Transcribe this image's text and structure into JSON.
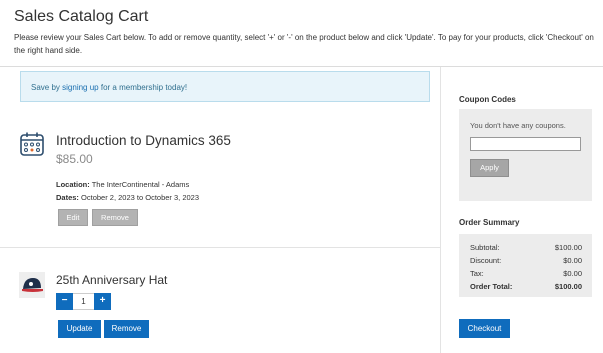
{
  "page": {
    "title": "Sales Catalog Cart",
    "intro": "Please review your Sales Cart below. To add or remove quantity, select '+' or '-' on the product below and click 'Update'. To pay for your products, click 'Checkout' on the right hand side."
  },
  "banner": {
    "prefix": "Save by ",
    "link": "signing up",
    "suffix": " for a membership today!"
  },
  "items": [
    {
      "title": "Introduction to Dynamics 365",
      "price": "$85.00",
      "location_label": "Location:",
      "location": " The InterContinental - Adams",
      "dates_label": "Dates:",
      "dates": " October 2, 2023 to October 3, 2023",
      "edit_label": "Edit",
      "remove_label": "Remove",
      "icon": "calendar-icon"
    },
    {
      "title": "25th Anniversary Hat",
      "quantity": "1",
      "minus_label": "−",
      "plus_label": "+",
      "update_label": "Update",
      "remove_label": "Remove",
      "icon": "hat-image"
    }
  ],
  "coupon": {
    "heading": "Coupon Codes",
    "empty_text": "You don't have any coupons.",
    "input_value": "",
    "apply_label": "Apply"
  },
  "summary": {
    "heading": "Order Summary",
    "rows": [
      {
        "label": "Subtotal:",
        "value": "$100.00"
      },
      {
        "label": "Discount:",
        "value": "$0.00"
      },
      {
        "label": "Tax:",
        "value": "$0.00"
      },
      {
        "label": "Order Total:",
        "value": "$100.00"
      }
    ],
    "checkout_label": "Checkout"
  },
  "colors": {
    "primary": "#0f6cbd",
    "banner_bg": "#e8f4fa",
    "muted_button": "#b3b3b3",
    "panel_bg": "#ececec"
  }
}
